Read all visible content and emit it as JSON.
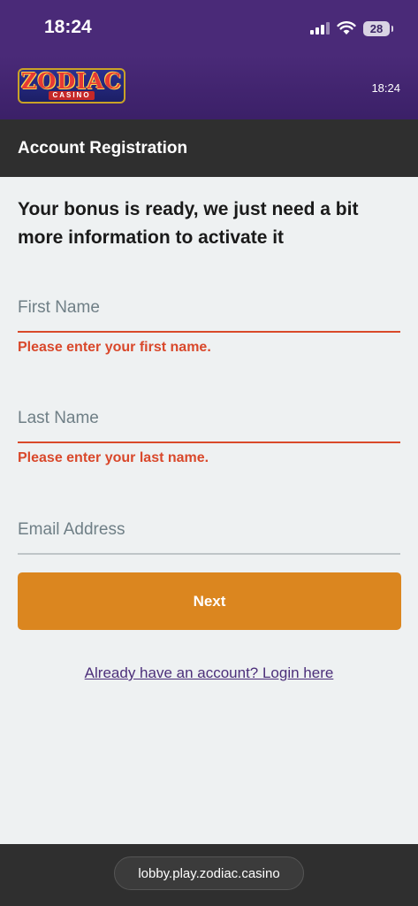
{
  "status_bar": {
    "time": "18:24",
    "battery": "28",
    "icons": [
      "signal-icon",
      "wifi-icon",
      "battery-icon"
    ]
  },
  "header": {
    "logo_main": "ZODIAC",
    "logo_sub": "CASINO",
    "time": "18:24"
  },
  "page": {
    "title": "Account Registration"
  },
  "form": {
    "intro": "Your bonus is ready, we just need a bit more information to activate it",
    "first_name": {
      "placeholder": "First Name",
      "value": "",
      "error": "Please enter your first name."
    },
    "last_name": {
      "placeholder": "Last Name",
      "value": "",
      "error": "Please enter your last name."
    },
    "email": {
      "placeholder": "Email Address",
      "value": ""
    },
    "next_label": "Next",
    "login_link": "Already have an account? Login here"
  },
  "browser": {
    "url": "lobby.play.zodiac.casino"
  },
  "colors": {
    "purple": "#4a2a78",
    "title_bar": "#2f2f2f",
    "error": "#d9482b",
    "button": "#db861f"
  }
}
